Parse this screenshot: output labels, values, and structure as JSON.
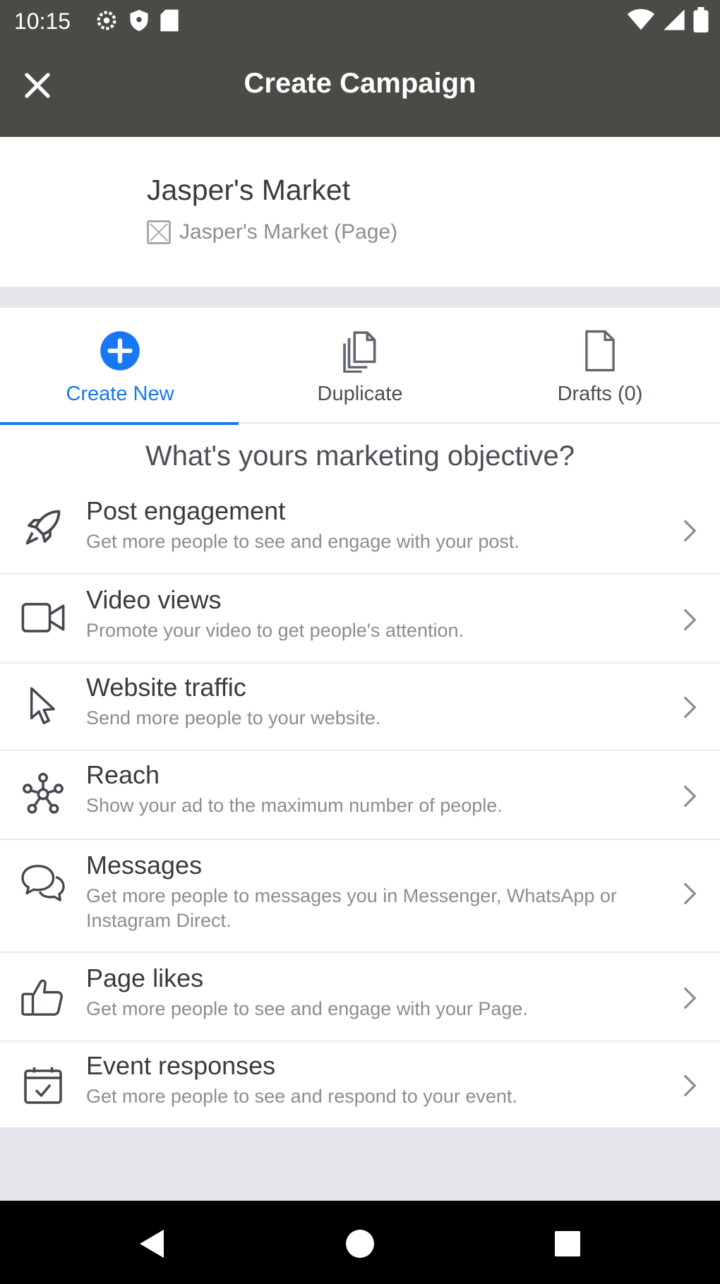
{
  "status_bar": {
    "time": "10:15"
  },
  "app_bar": {
    "title": "Create Campaign",
    "close_icon": "close-icon"
  },
  "account": {
    "name": "Jasper's Market",
    "page_label": "Jasper's Market (Page)"
  },
  "tabs": [
    {
      "label": "Create New",
      "icon": "plus-circle-icon",
      "active": true
    },
    {
      "label": "Duplicate",
      "icon": "duplicate-icon",
      "active": false
    },
    {
      "label": "Drafts (0)",
      "icon": "draft-icon",
      "active": false
    }
  ],
  "heading": "What's yours marketing objective?",
  "objectives": [
    {
      "title": "Post engagement",
      "desc": "Get more people to see and engage with your post.",
      "icon": "rocket-icon"
    },
    {
      "title": "Video views",
      "desc": "Promote your video to get people's attention.",
      "icon": "video-camera-icon"
    },
    {
      "title": "Website traffic",
      "desc": "Send more people to your website.",
      "icon": "cursor-icon"
    },
    {
      "title": "Reach",
      "desc": "Show your ad to the maximum number of people.",
      "icon": "reach-network-icon"
    },
    {
      "title": "Messages",
      "desc": "Get more people to messages you in Messenger, WhatsApp or Instagram Direct.",
      "icon": "chat-bubbles-icon"
    },
    {
      "title": "Page likes",
      "desc": "Get more people to see and engage with your Page.",
      "icon": "thumbs-up-icon"
    },
    {
      "title": "Event responses",
      "desc": "Get more people to see and respond to your event.",
      "icon": "calendar-check-icon"
    }
  ],
  "colors": {
    "header_bg": "#494c46",
    "accent": "#1877f2",
    "band": "#e4e6eb"
  }
}
